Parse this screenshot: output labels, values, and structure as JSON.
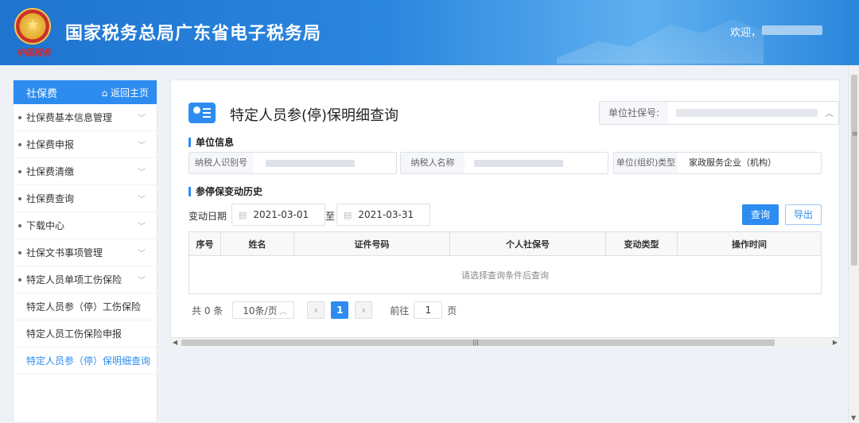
{
  "header": {
    "site_title": "国家税务总局广东省电子税务局",
    "emblem_script": "中国税务",
    "welcome": "欢迎，"
  },
  "sidebar": {
    "title": "社保费",
    "home_link": "⌂ 返回主页",
    "items": [
      {
        "label": "社保费基本信息管理"
      },
      {
        "label": "社保费申报"
      },
      {
        "label": "社保费清缴"
      },
      {
        "label": "社保费查询"
      },
      {
        "label": "下载中心"
      },
      {
        "label": "社保文书事项管理"
      },
      {
        "label": "特定人员单项工伤保险"
      }
    ],
    "sub_items": [
      {
        "label": "特定人员参（停）工伤保险"
      },
      {
        "label": "特定人员工伤保险申报"
      },
      {
        "label": "特定人员参（停）保明细查询"
      }
    ]
  },
  "main": {
    "page_title": "特定人员参(停)保明细查询",
    "ssn_label": "单位社保号:",
    "unit_section": "单位信息",
    "fields": {
      "taxpayer_id_label": "纳税人识别号",
      "taxpayer_name_label": "纳税人名称",
      "unit_type_label": "单位(组织)类型",
      "unit_type_value": "家政服务企业（机构）"
    },
    "history_section": "参停保变动历史",
    "date_label": "变动日期",
    "date_from": "2021-03-01",
    "date_sep": "至",
    "date_to": "2021-03-31",
    "query_button": "查询",
    "export_button": "导出",
    "table": {
      "columns": [
        "序号",
        "姓名",
        "证件号码",
        "个人社保号",
        "变动类型",
        "操作时间"
      ],
      "empty_text": "请选择查询条件后查询"
    },
    "pager": {
      "total": "共 0 条",
      "page_size": "10条/页",
      "current_page": "1",
      "goto_label": "前往",
      "goto_value": "1",
      "page_suffix": "页"
    }
  }
}
